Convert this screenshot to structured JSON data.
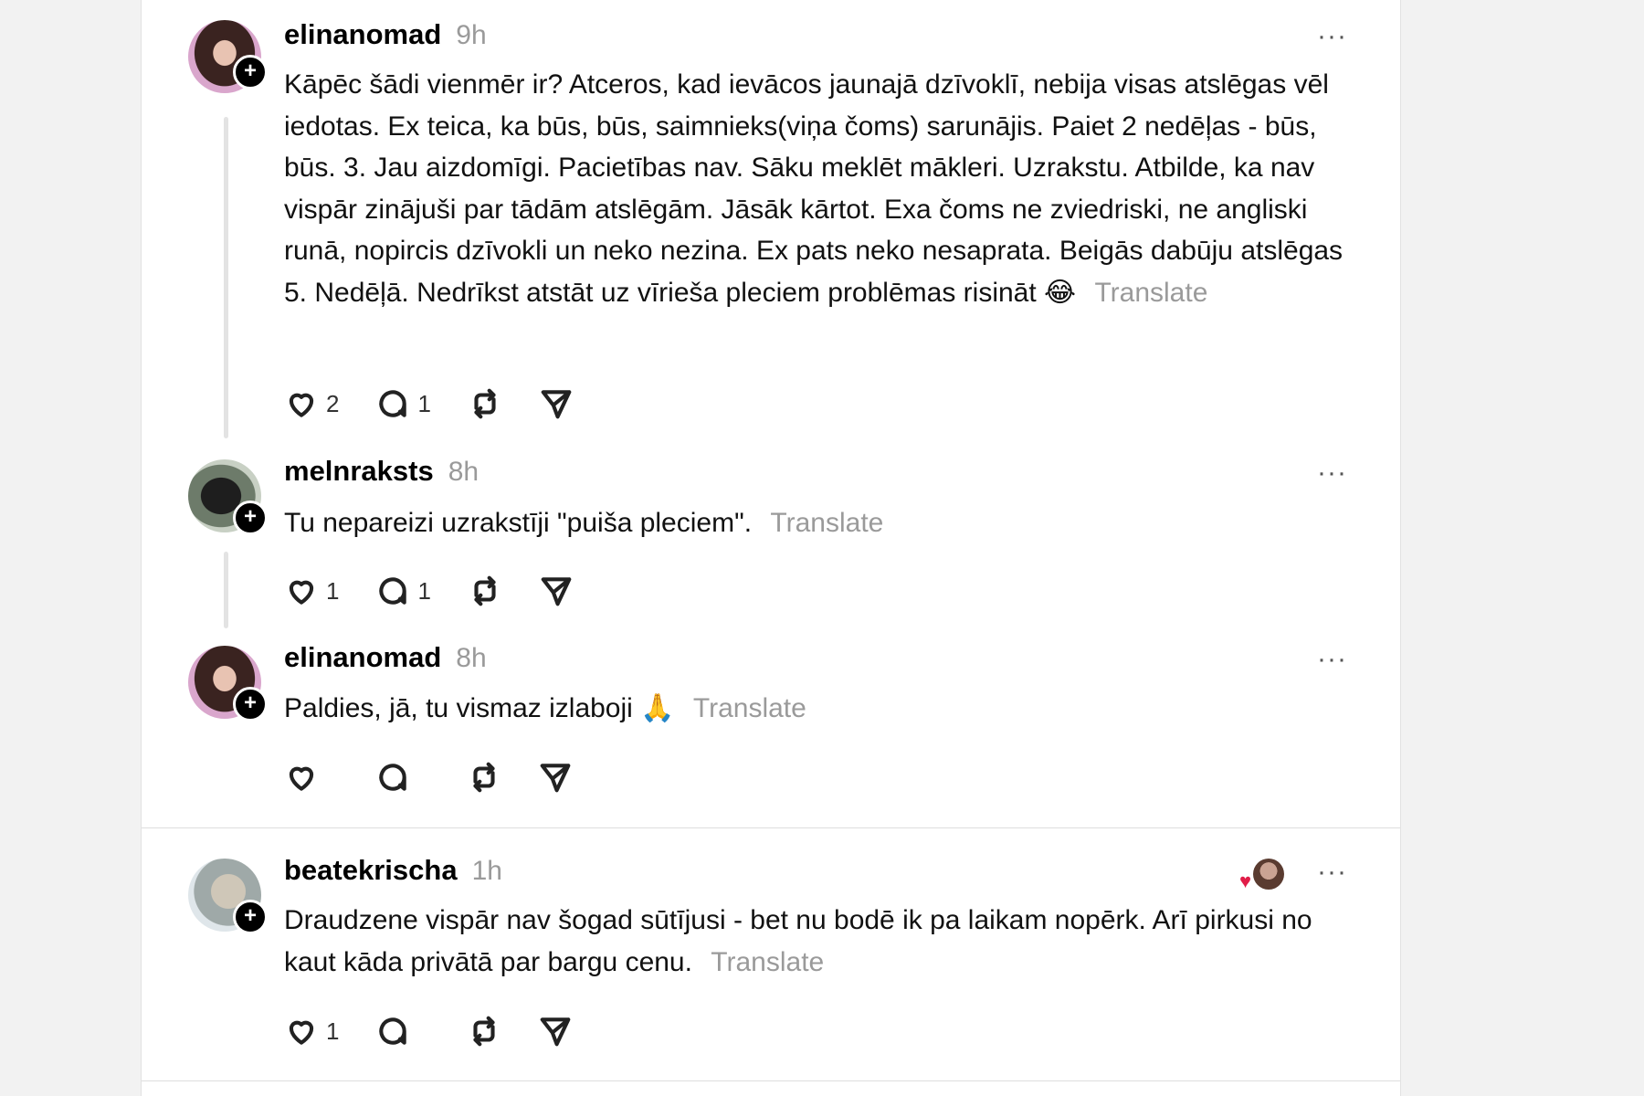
{
  "posts": [
    {
      "username": "elinanomad",
      "time": "9h",
      "text": "Kāpēc šādi vienmēr ir? Atceros, kad ievācos jaunajā dzīvoklī, nebija visas atslēgas vēl iedotas. Ex teica, ka būs, būs, saimnieks(viņa čoms) sarunājis. Paiet 2 nedēļas - būs, būs. 3. Jau aizdomīgi. Pacietības nav. Sāku meklēt mākleri. Uzrakstu. Atbilde, ka nav vispār zinājuši par tādām atslēgām. Jāsāk kārtot. Exa čoms ne zviedriski, ne angliski runā, nopircis dzīvokli un neko nezina. Ex pats neko nesaprata. Beigās dabūju atslēgas 5. Nedēļā. Nedrīkst atstāt uz vīrieša pleciem problēmas risināt",
      "emoji": "😂",
      "translate": "Translate",
      "likes": "2",
      "replies": "1"
    },
    {
      "username": "melnraksts",
      "time": "8h",
      "text": "Tu nepareizi uzrakstīji \"puiša pleciem\".",
      "translate": "Translate",
      "likes": "1",
      "replies": "1"
    },
    {
      "username": "elinanomad",
      "time": "8h",
      "text": "Paldies, jā, tu vismaz izlaboji",
      "emoji": "🙏",
      "translate": "Translate",
      "likes": "",
      "replies": ""
    },
    {
      "username": "beatekrischa",
      "time": "1h",
      "text": "Draudzene vispār nav šogad sūtījusi - bet nu bodē ik pa laikam nopērk. Arī pirkusi no kaut kāda privātā par bargu cenu.",
      "translate": "Translate",
      "likes": "1",
      "replies": ""
    }
  ],
  "ui": {
    "more_label": "···",
    "plus_label": "+",
    "heart_glyph": "♥"
  },
  "colors": {
    "text": "#111111",
    "muted": "#9a9a9a",
    "like_heart": "#e11d48"
  }
}
